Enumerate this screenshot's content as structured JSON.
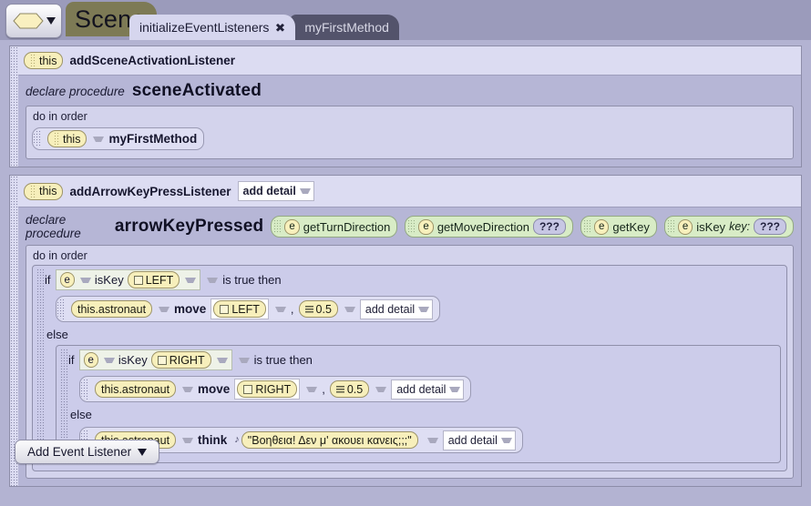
{
  "topbar": {
    "class_picker": {
      "icon": "hexagon-icon",
      "caret": "caret-down-icon"
    },
    "scene_label": "Scene",
    "tabs": [
      {
        "label": "initializeEventListeners",
        "active": true,
        "close": "✖"
      },
      {
        "label": "myFirstMethod",
        "active": false
      }
    ]
  },
  "listeners": [
    {
      "target": "this",
      "name": "addSceneActivationListener",
      "declare_label": "declare procedure",
      "procedure": "sceneActivated",
      "do_label": "do in order",
      "statements": [
        {
          "target": "this",
          "call": "myFirstMethod"
        }
      ]
    },
    {
      "target": "this",
      "name": "addArrowKeyPressListener",
      "add_detail": "add detail",
      "declare_label": "declare procedure",
      "procedure": "arrowKeyPressed",
      "params": [
        {
          "icon": "e",
          "name": "getTurnDirection"
        },
        {
          "icon": "e",
          "name": "getMoveDirection",
          "value": "???"
        },
        {
          "icon": "e",
          "name": "getKey"
        },
        {
          "icon": "e",
          "name": "isKey",
          "arg_label": "key:",
          "value": "???"
        }
      ],
      "do_label": "do in order"
    }
  ],
  "logic": {
    "if_label": "if",
    "is_true_then": "is true then",
    "else_label": "else",
    "outer": {
      "condition": {
        "icon": "e",
        "fn": "isKey",
        "arg": "LEFT"
      },
      "then": {
        "object": "this.astronaut",
        "method": "move",
        "arg1": "LEFT",
        "comma": ",",
        "arg2": "0.5",
        "add_detail": "add detail"
      }
    },
    "inner": {
      "condition": {
        "icon": "e",
        "fn": "isKey",
        "arg": "RIGHT"
      },
      "then": {
        "object": "this.astronaut",
        "method": "move",
        "arg1": "RIGHT",
        "comma": ",",
        "arg2": "0.5",
        "add_detail": "add detail"
      },
      "else": {
        "object": "this.astronaut",
        "method": "think",
        "arg1": "\"Βοηθεια! Δεν μ' ακουει κανεις;;;\"",
        "add_detail": "add detail"
      }
    }
  },
  "footer": {
    "add_event_listener": "Add Event Listener"
  }
}
